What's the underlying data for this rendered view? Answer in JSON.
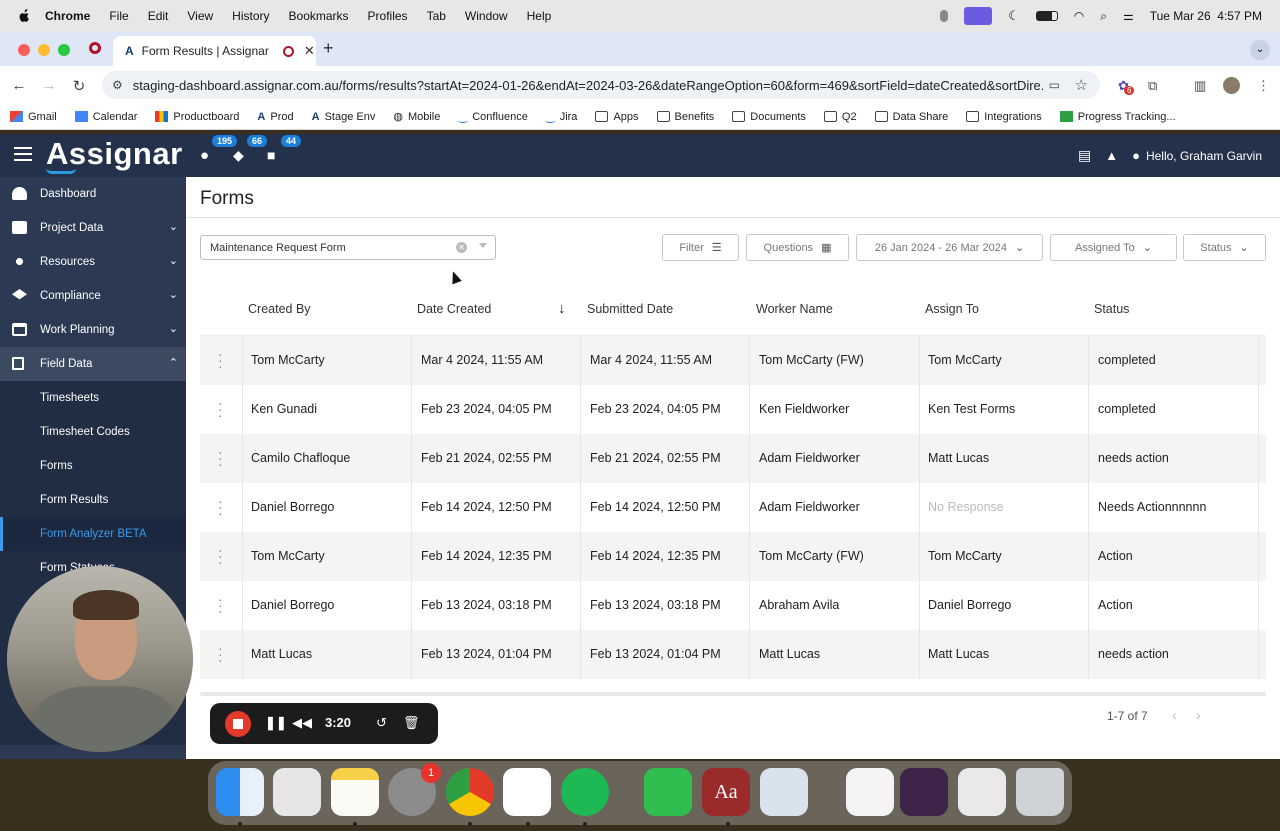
{
  "menubar": {
    "app": "Chrome",
    "items": [
      "File",
      "Edit",
      "View",
      "History",
      "Bookmarks",
      "Profiles",
      "Tab",
      "Window",
      "Help"
    ],
    "datetime": "Tue Mar 26  4:57 PM"
  },
  "browser": {
    "tab_title": "Form Results | Assignar",
    "url": "staging-dashboard.assignar.com.au/forms/results?startAt=2024-01-26&endAt=2024-03-26&dateRangeOption=60&form=469&sortField=dateCreated&sortDire...",
    "extension_badge": "6",
    "bookmarks": [
      "Gmail",
      "Calendar",
      "Productboard",
      "Prod",
      "Stage Env",
      "Mobile",
      "Confluence",
      "Jira",
      "Apps",
      "Benefits",
      "Documents",
      "Q2",
      "Data Share",
      "Integrations",
      "Progress Tracking..."
    ]
  },
  "header": {
    "logo": "Assignar",
    "badges": [
      "195",
      "66",
      "44"
    ],
    "greeting": "Hello, Graham Garvin"
  },
  "sidebar": {
    "items": [
      {
        "label": "Dashboard",
        "icon": "speedometer-icon",
        "expandable": false
      },
      {
        "label": "Project Data",
        "icon": "briefcase-icon",
        "expandable": true
      },
      {
        "label": "Resources",
        "icon": "network-icon",
        "expandable": true
      },
      {
        "label": "Compliance",
        "icon": "graduation-cap-icon",
        "expandable": true
      },
      {
        "label": "Work Planning",
        "icon": "calendar-icon",
        "expandable": true
      },
      {
        "label": "Field Data",
        "icon": "document-icon",
        "expandable": true
      }
    ],
    "subitems": [
      "Timesheets",
      "Timesheet Codes",
      "Forms",
      "Form Results",
      "Form Analyzer BETA",
      "Form Statuses"
    ],
    "active_subitem": "Form Analyzer BETA"
  },
  "page": {
    "title": "Forms",
    "form_select": "Maintenance Request Form",
    "filters": {
      "filter": "Filter",
      "questions": "Questions",
      "date_range": "26 Jan 2024 - 26 Mar 2024",
      "assigned_to": "Assigned To",
      "status": "Status"
    },
    "columns": [
      "Created By",
      "Date Created",
      "Submitted Date",
      "Worker Name",
      "Assign To",
      "Status"
    ],
    "rows": [
      {
        "created_by": "Tom McCarty",
        "date_created": "Mar 4 2024, 11:55 AM",
        "submitted": "Mar 4 2024, 11:55 AM",
        "worker": "Tom McCarty (FW)",
        "assign_to": "Tom McCarty",
        "status": "completed"
      },
      {
        "created_by": "Ken Gunadi",
        "date_created": "Feb 23 2024, 04:05 PM",
        "submitted": "Feb 23 2024, 04:05 PM",
        "worker": "Ken Fieldworker",
        "assign_to": "Ken Test Forms",
        "status": "completed"
      },
      {
        "created_by": "Camilo Chafloque",
        "date_created": "Feb 21 2024, 02:55 PM",
        "submitted": "Feb 21 2024, 02:55 PM",
        "worker": "Adam Fieldworker",
        "assign_to": "Matt Lucas",
        "status": "needs action"
      },
      {
        "created_by": "Daniel Borrego",
        "date_created": "Feb 14 2024, 12:50 PM",
        "submitted": "Feb 14 2024, 12:50 PM",
        "worker": "Adam Fieldworker",
        "assign_to": "No Response",
        "status": "Needs Actionnnnnn"
      },
      {
        "created_by": "Tom McCarty",
        "date_created": "Feb 14 2024, 12:35 PM",
        "submitted": "Feb 14 2024, 12:35 PM",
        "worker": "Tom McCarty (FW)",
        "assign_to": "Tom McCarty",
        "status": "Action"
      },
      {
        "created_by": "Daniel Borrego",
        "date_created": "Feb 13 2024, 03:18 PM",
        "submitted": "Feb 13 2024, 03:18 PM",
        "worker": "Abraham Avila",
        "assign_to": "Daniel Borrego",
        "status": "Action"
      },
      {
        "created_by": "Matt Lucas",
        "date_created": "Feb 13 2024, 01:04 PM",
        "submitted": "Feb 13 2024, 01:04 PM",
        "worker": "Matt Lucas",
        "assign_to": "Matt Lucas",
        "status": "needs action"
      }
    ],
    "pagination": "1-7 of 7"
  },
  "recorder": {
    "time": "3:20"
  },
  "dock": {
    "settings_badge": "1"
  },
  "colors": {
    "sidebar_bg": "#2b3a52",
    "header_bg": "#23324a",
    "accent": "#3a9ae8",
    "record_red": "#e33a2a"
  }
}
